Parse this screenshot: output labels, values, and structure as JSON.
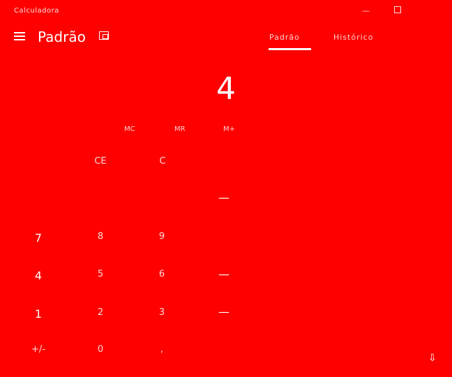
{
  "window": {
    "title": "Calculadora",
    "minimize_glyph": "—",
    "maximize_glyph": ""
  },
  "header": {
    "mode_title": "Padrão",
    "tabs": [
      {
        "label": "Padrão",
        "active": true
      },
      {
        "label": "Histórico",
        "active": false
      }
    ]
  },
  "display": {
    "value": "4"
  },
  "memory": {
    "mc": "MC",
    "mr": "MR",
    "m_plus": "M+"
  },
  "keys": {
    "ce": "CE",
    "c": "C",
    "op_row2": "—",
    "seven": "7",
    "eight": "8",
    "nine": "9",
    "four": "4",
    "five": "5",
    "six": "6",
    "one": "1",
    "two": "2",
    "three": "3",
    "sign": "+/-",
    "zero": "0",
    "dot": ",",
    "op_row4": "—",
    "op_row5": "—"
  },
  "footer": {
    "corner_glyph": "⇩"
  },
  "colors": {
    "background": "#ff0000",
    "text": "#ffffff"
  }
}
